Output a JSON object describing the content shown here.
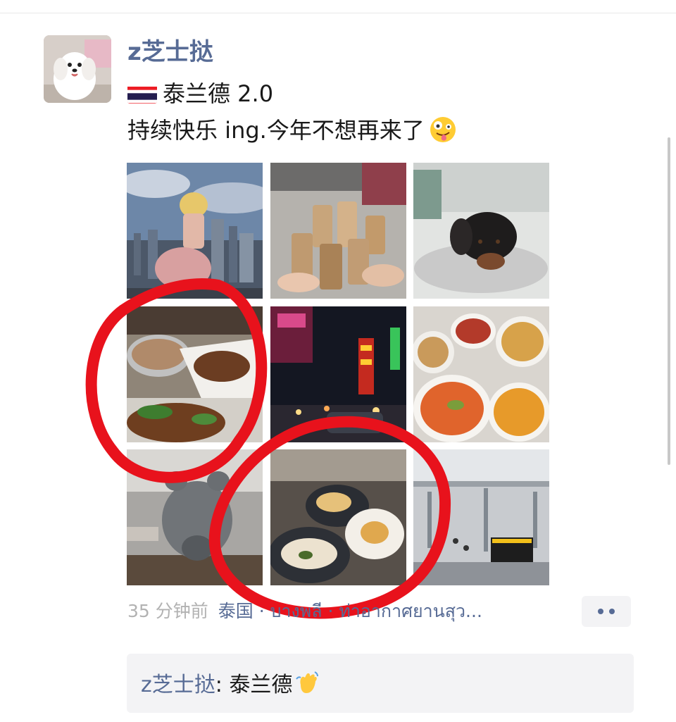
{
  "post": {
    "username": "z芝士挞",
    "line1": "泰兰德 2.0",
    "line2": "持续快乐 ing.今年不想再来了",
    "flag_icon": "thailand-flag-icon",
    "emoji_icon": "zany-face-emoji",
    "photos": [
      {
        "name": "photo-figure-skyline"
      },
      {
        "name": "photo-drinks"
      },
      {
        "name": "photo-dog-statue"
      },
      {
        "name": "photo-thai-food"
      },
      {
        "name": "photo-night-street"
      },
      {
        "name": "photo-noodle-soups"
      },
      {
        "name": "photo-bear-statue"
      },
      {
        "name": "photo-dessert-plates"
      },
      {
        "name": "photo-airport"
      }
    ],
    "time": "35 分钟前",
    "location": "泰国 · บางพลี · ท่าอากาศยานสุว..."
  },
  "comments": [
    {
      "author": "z芝士挞",
      "separator": ": ",
      "text": "泰兰德"
    }
  ],
  "colors": {
    "link": "#576b95",
    "annotation": "#e8121c",
    "comment_bg": "#f3f3f5"
  }
}
